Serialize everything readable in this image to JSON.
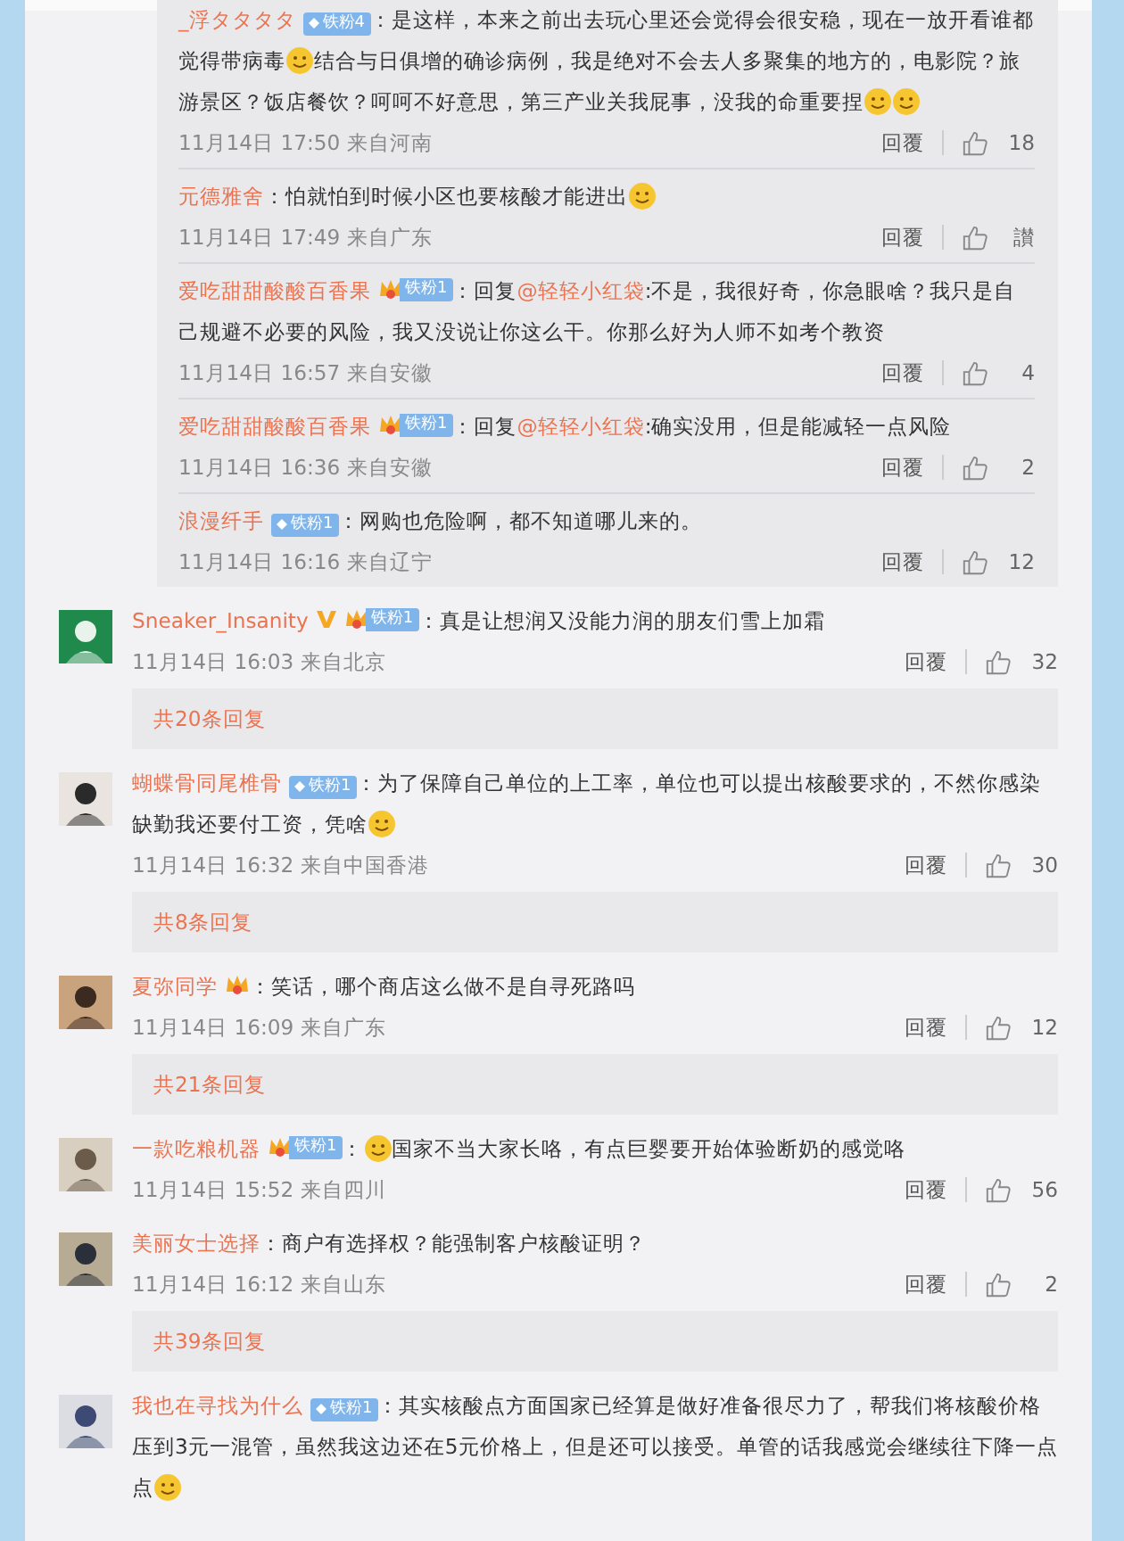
{
  "replies_panel": {
    "replies": [
      {
        "name": "_浮タタタタ",
        "badges": [
          {
            "kind": "diamond",
            "label": "铁粉4"
          }
        ],
        "sep": "：",
        "segments": [
          {
            "kind": "text",
            "text": "是这样，本来之前出去玩心里还会觉得会很安稳，现在一放开看谁都觉得带病毒"
          },
          {
            "kind": "emoji"
          },
          {
            "kind": "text",
            "text": "结合与日俱增的确诊病例，我是绝对不会去人多聚集的地方的，电影院？旅游景区？饭店餐饮？呵呵不好意思，第三产业关我屁事，没我的命重要捏"
          },
          {
            "kind": "emoji"
          },
          {
            "kind": "emoji"
          }
        ],
        "time": "11月14日 17:50 来自河南",
        "reply": "回覆",
        "likes": "18"
      },
      {
        "name": "元德雅舍",
        "sep": "：",
        "segments": [
          {
            "kind": "text",
            "text": "怕就怕到时候小区也要核酸才能进出"
          },
          {
            "kind": "emoji"
          }
        ],
        "time": "11月14日 17:49 来自广东",
        "reply": "回覆",
        "likes": "讃"
      },
      {
        "name": "爱吃甜甜酸酸百香果",
        "badges": [
          {
            "kind": "crown",
            "label": "铁粉1"
          }
        ],
        "sep": "：",
        "segments": [
          {
            "kind": "text",
            "text": "回复"
          },
          {
            "kind": "mention",
            "text": "@轻轻小红袋"
          },
          {
            "kind": "text",
            "text": ":不是，我很好奇，你急眼啥？我只是自己规避不必要的风险，我又没说让你这么干。你那么好为人师不如考个教资"
          }
        ],
        "time": "11月14日 16:57 来自安徽",
        "reply": "回覆",
        "likes": "4"
      },
      {
        "name": "爱吃甜甜酸酸百香果",
        "badges": [
          {
            "kind": "crown",
            "label": "铁粉1"
          }
        ],
        "sep": "：",
        "segments": [
          {
            "kind": "text",
            "text": "回复"
          },
          {
            "kind": "mention",
            "text": "@轻轻小红袋"
          },
          {
            "kind": "text",
            "text": ":确实没用，但是能减轻一点风险"
          }
        ],
        "time": "11月14日 16:36 来自安徽",
        "reply": "回覆",
        "likes": "2"
      },
      {
        "name": "浪漫纤手",
        "badges": [
          {
            "kind": "diamond",
            "label": "铁粉1"
          }
        ],
        "sep": "：",
        "segments": [
          {
            "kind": "text",
            "text": "网购也危险啊，都不知道哪儿来的。"
          }
        ],
        "time": "11月14日 16:16 来自辽宁",
        "reply": "回覆",
        "likes": "12"
      }
    ]
  },
  "comments": [
    {
      "avatar": {
        "kind": "picture"
      },
      "name": "Sneaker_Insanity",
      "badges": [
        {
          "kind": "verified"
        },
        {
          "kind": "crown",
          "label": "铁粉1"
        }
      ],
      "sep": "：",
      "segments": [
        {
          "kind": "text",
          "text": "真是让想润又没能力润的朋友们雪上加霜"
        }
      ],
      "time": "11月14日 16:03 来自北京",
      "reply": "回覆",
      "likes": "32",
      "more_replies": "共20条回复"
    },
    {
      "avatar": {
        "kind": "picture"
      },
      "name": "蝴蝶骨同尾椎骨",
      "badges": [
        {
          "kind": "diamond",
          "label": "铁粉1"
        }
      ],
      "sep": "：",
      "segments": [
        {
          "kind": "text",
          "text": "为了保障自己单位的上工率，单位也可以提出核酸要求的，不然你感染缺勤我还要付工资，凭啥"
        },
        {
          "kind": "emoji"
        }
      ],
      "time": "11月14日 16:32 来自中国香港",
      "reply": "回覆",
      "likes": "30",
      "more_replies": "共8条回复"
    },
    {
      "avatar": {
        "kind": "picture"
      },
      "name": "夏弥同学",
      "badges": [
        {
          "kind": "crown"
        }
      ],
      "sep": "：",
      "segments": [
        {
          "kind": "text",
          "text": "笑话，哪个商店这么做不是自寻死路吗"
        }
      ],
      "time": "11月14日 16:09 来自广东",
      "reply": "回覆",
      "likes": "12",
      "more_replies": "共21条回复"
    },
    {
      "avatar": {
        "kind": "picture"
      },
      "name": "一款吃粮机器",
      "badges": [
        {
          "kind": "crown",
          "label": "铁粉1"
        }
      ],
      "sep": "：",
      "segments": [
        {
          "kind": "emoji"
        },
        {
          "kind": "text",
          "text": "国家不当大家长咯，有点巨婴要开始体验断奶的感觉咯"
        }
      ],
      "time": "11月14日 15:52 来自四川",
      "reply": "回覆",
      "likes": "56"
    },
    {
      "avatar": {
        "kind": "picture"
      },
      "name": "美丽女士选择",
      "sep": "：",
      "segments": [
        {
          "kind": "text",
          "text": "商户有选择权？能强制客户核酸证明？"
        }
      ],
      "time": "11月14日 16:12 来自山东",
      "reply": "回覆",
      "likes": "2",
      "more_replies": "共39条回复"
    },
    {
      "avatar": {
        "kind": "picture"
      },
      "name": "我也在寻找为什么",
      "badges": [
        {
          "kind": "diamond",
          "label": "铁粉1"
        }
      ],
      "sep": "：",
      "segments": [
        {
          "kind": "text",
          "text": "其实核酸点方面国家已经算是做好准备很尽力了，帮我们将核酸价格压到3元一混管，虽然我这边还在5元价格上，但是还可以接受。单管的话我感觉会继续往下降一点点"
        },
        {
          "kind": "emoji"
        }
      ]
    }
  ]
}
